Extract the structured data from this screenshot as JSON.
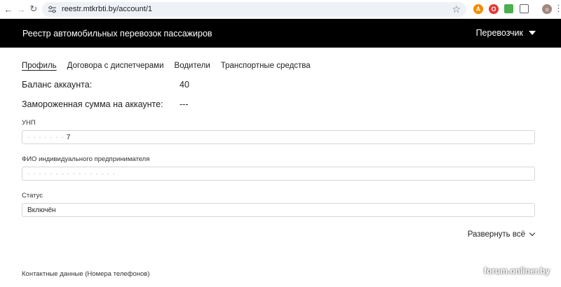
{
  "browser": {
    "url": "reestr.mtkrbti.by/account/1",
    "profile_initial": "о",
    "icons": [
      "back-arrow-icon",
      "forward-arrow-icon",
      "reload-icon",
      "site-settings-icon",
      "bookmark-star-icon",
      "extension-icons",
      "extensions-puzzle-icon",
      "kebab-menu-icon"
    ]
  },
  "header": {
    "title": "Реестр автомобильных перевозок пассажиров",
    "role": "Перевозчик",
    "background": "#000000"
  },
  "tabs": [
    {
      "label": "Профиль",
      "active": true
    },
    {
      "label": "Договора с диспетчерами",
      "active": false
    },
    {
      "label": "Водители",
      "active": false
    },
    {
      "label": "Транспортные средства",
      "active": false
    }
  ],
  "account": {
    "balance_label": "Баланс аккаунта:",
    "balance_value": "40",
    "frozen_label": "Замороженная сумма на аккаунте:",
    "frozen_value": "---"
  },
  "fields": {
    "unp": {
      "label": "УНП",
      "value": "7"
    },
    "fio": {
      "label": "ФИО индивидуального предпринимателя",
      "value": ""
    },
    "status": {
      "label": "Статус",
      "value": "Включён"
    }
  },
  "expand_all_label": "Развернуть всё",
  "contacts_section_title": "Контактные данные (Номера телефонов)",
  "watermark": "forum.onliner.by"
}
